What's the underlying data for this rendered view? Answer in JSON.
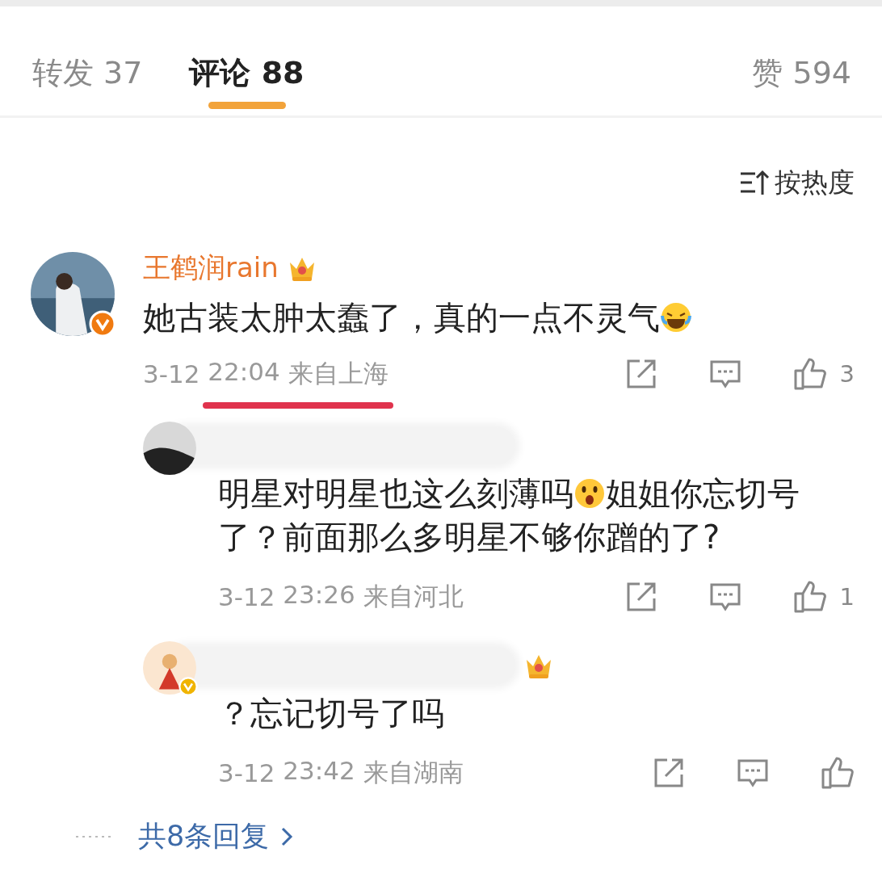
{
  "tabs": [
    {
      "label": "转发 37",
      "selected": false
    },
    {
      "label": "评论 88",
      "selected": true
    }
  ],
  "likes_tab": {
    "label": "赞 594"
  },
  "sort": {
    "label": "按热度"
  },
  "comments": [
    {
      "name": "王鹤润rain",
      "name_hidden": false,
      "crown": true,
      "verified": true,
      "text": [
        {
          "kind": "text",
          "value": "她古装太肿太蠢了，真的一点不灵气"
        },
        {
          "kind": "laughing_emoji"
        }
      ],
      "date": "3-12",
      "time": "22:04",
      "location": "来自上海",
      "underlined": true,
      "likes": "3",
      "replies": [
        {
          "name_hidden": true,
          "crown": false,
          "verified": false,
          "text": [
            {
              "kind": "text",
              "value": "明星对明星也这么刻薄吗"
            },
            {
              "kind": "shocked_emoji"
            },
            {
              "kind": "text",
              "value": "姐姐你忘切号"
            },
            {
              "kind": "text",
              "value": "了？前面那么多明星不够你蹭的了?"
            }
          ],
          "date": "3-12",
          "time": "23:26",
          "location": "来自河北",
          "underlined": false,
          "likes": "1"
        },
        {
          "name_hidden": true,
          "crown": true,
          "verified": true,
          "text": [
            {
              "kind": "text",
              "value": "？忘记切号了吗"
            }
          ],
          "date": "3-12",
          "time": "23:42",
          "location": "来自湖南",
          "underlined": false
        }
      ],
      "more_replies": "共8条回复"
    }
  ]
}
